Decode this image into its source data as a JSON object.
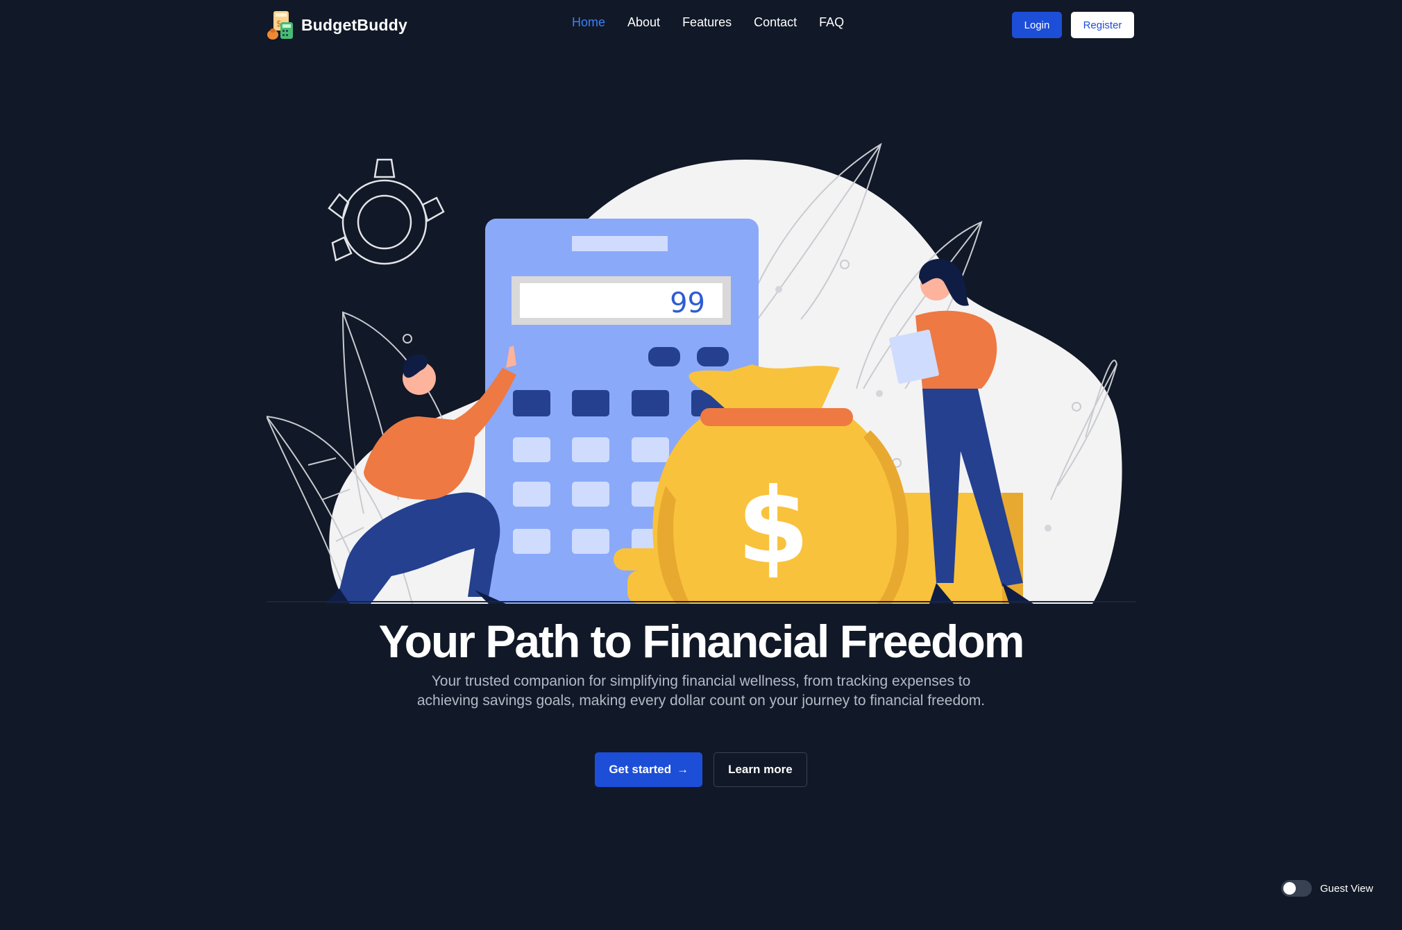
{
  "brand": {
    "name": "BudgetBuddy",
    "logo_icon": "calculator-money-icon"
  },
  "nav": {
    "links": [
      {
        "label": "Home",
        "active": true
      },
      {
        "label": "About",
        "active": false
      },
      {
        "label": "Features",
        "active": false
      },
      {
        "label": "Contact",
        "active": false
      },
      {
        "label": "FAQ",
        "active": false
      }
    ],
    "login_label": "Login",
    "register_label": "Register"
  },
  "hero": {
    "illustration": {
      "calculator_display": "99",
      "bag_symbol": "$"
    },
    "title": "Your Path to Financial Freedom",
    "subtitle": "Your trusted companion for simplifying financial wellness, from tracking expenses to achieving savings goals, making every dollar count on your journey to financial freedom.",
    "primary_cta": "Get started",
    "primary_cta_icon": "arrow-right-icon",
    "secondary_cta": "Learn more"
  },
  "guest_toggle": {
    "label": "Guest View",
    "enabled": false
  },
  "colors": {
    "background": "#111827",
    "accent": "#1d4ed8",
    "active_link": "#3b82f6",
    "orange": "#ee7942",
    "navy": "#1f3a8f",
    "gold": "#f9c23c"
  }
}
